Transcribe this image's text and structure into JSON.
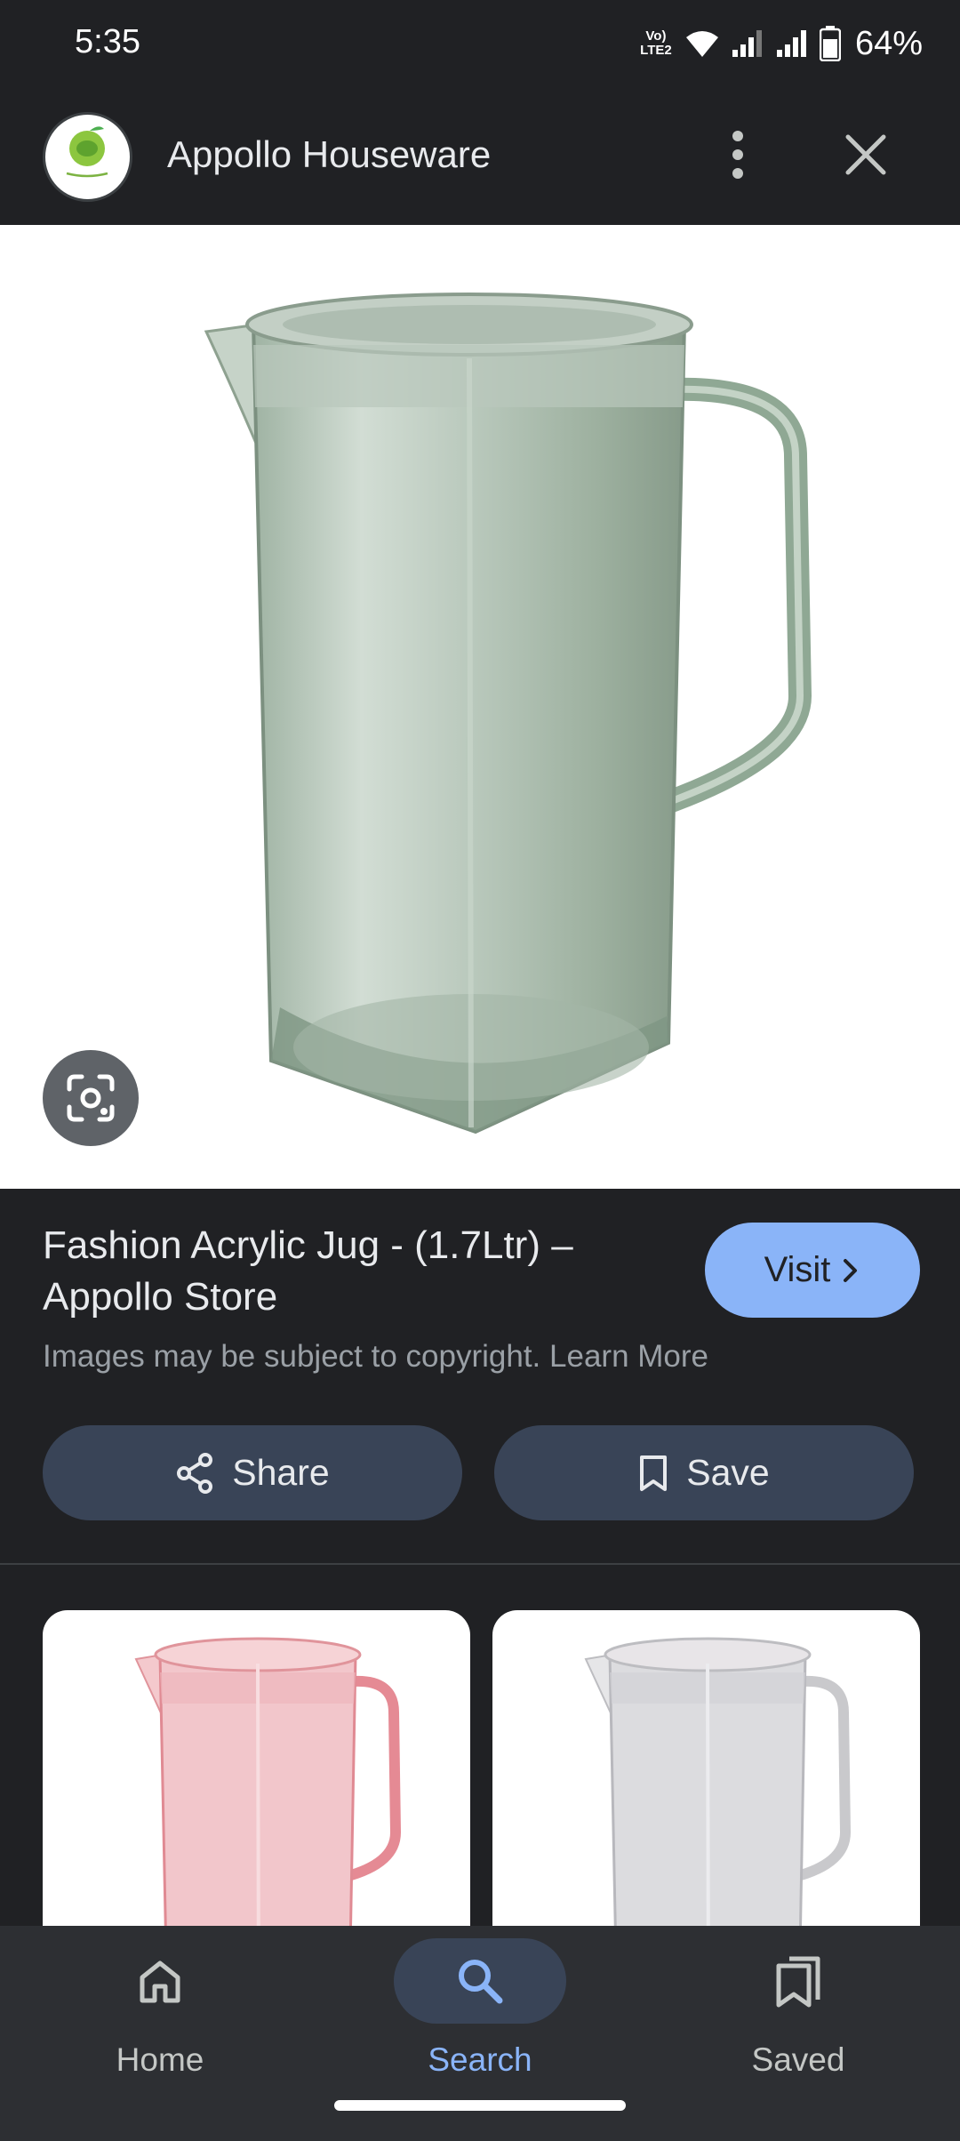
{
  "status_bar": {
    "time": "5:35",
    "network_label": "Vo) LTE2",
    "battery": "64%"
  },
  "header": {
    "site_name": "Appollo Houseware",
    "logo_icon": "appollo-houseware-logo",
    "more_icon": "more-vert-icon",
    "close_icon": "close-icon"
  },
  "image": {
    "subject": "green translucent acrylic jug",
    "lens_icon": "google-lens-icon"
  },
  "result": {
    "title": "Fashion Acrylic Jug - (1.7Ltr) – Appollo Store",
    "visit_label": "Visit",
    "copyright_text": "Images may be subject to copyright.",
    "learn_more_label": "Learn More",
    "share_label": "Share",
    "save_label": "Save"
  },
  "related": [
    {
      "subject": "pink translucent acrylic jug"
    },
    {
      "subject": "clear translucent acrylic jug"
    }
  ],
  "bottom_nav": {
    "items": [
      {
        "label": "Home",
        "icon": "home-icon",
        "active": false
      },
      {
        "label": "Search",
        "icon": "search-icon",
        "active": true
      },
      {
        "label": "Saved",
        "icon": "saved-collections-icon",
        "active": false
      }
    ]
  },
  "colors": {
    "background": "#202124",
    "accent": "#8ab4f8",
    "button_bg": "#394457",
    "nav_bg": "#2d2f33"
  }
}
